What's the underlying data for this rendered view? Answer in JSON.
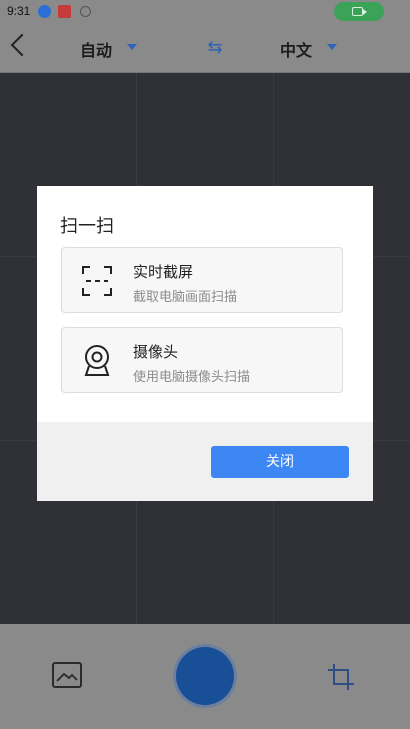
{
  "status_bar": {
    "time": "9:31"
  },
  "header": {
    "source_language": "自动",
    "target_language": "中文"
  },
  "dialog": {
    "title": "扫一扫",
    "options": [
      {
        "title": "实时截屏",
        "subtitle": "截取电脑画面扫描",
        "icon": "screen-capture-icon"
      },
      {
        "title": "摄像头",
        "subtitle": "使用电脑摄像头扫描",
        "icon": "webcam-icon"
      }
    ],
    "close_label": "关闭"
  },
  "colors": {
    "primary_button": "#3d87f5",
    "accent_blue": "#2e63b8",
    "recording_green": "#3aa357"
  }
}
